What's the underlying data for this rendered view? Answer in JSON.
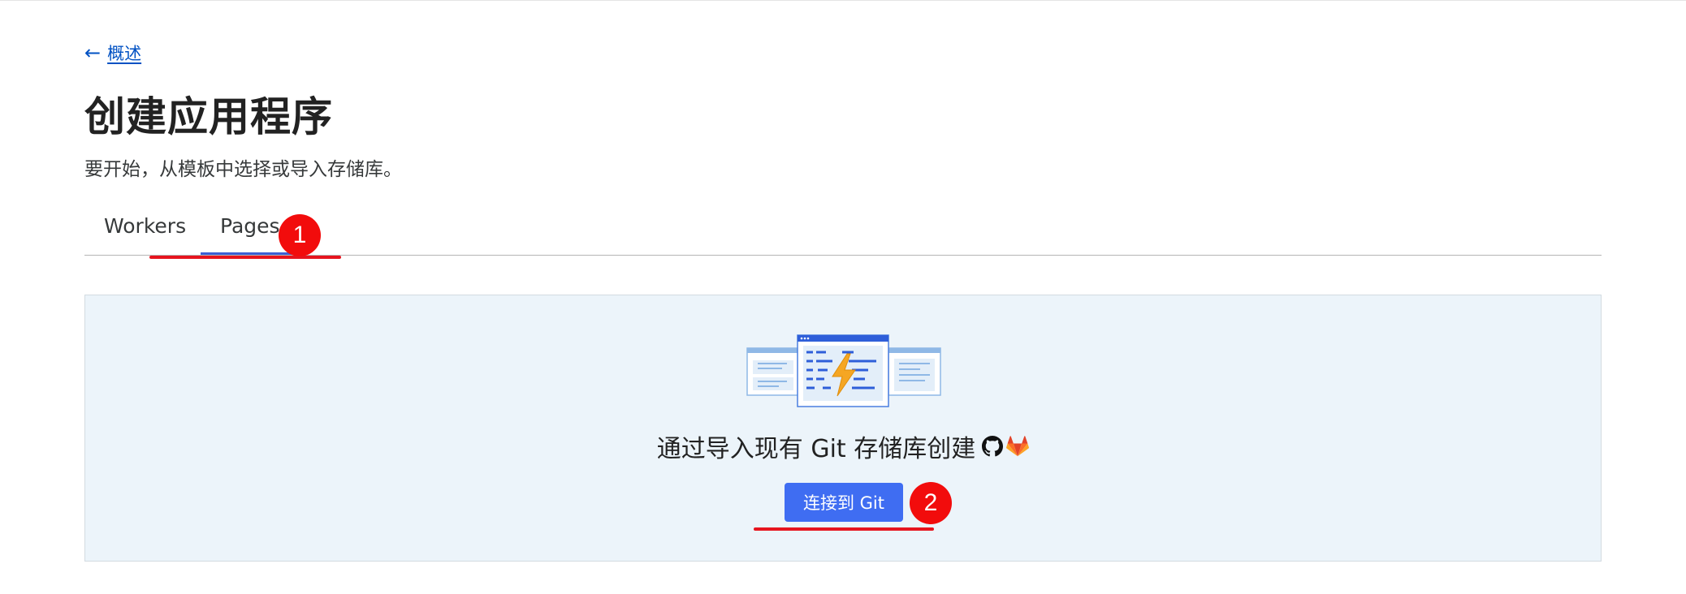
{
  "nav": {
    "back_label": "概述",
    "back_icon": "arrow-left-icon"
  },
  "header": {
    "title": "创建应用程序",
    "subtitle": "要开始，从模板中选择或导入存储库。"
  },
  "tabs": [
    {
      "label": "Workers",
      "active": false
    },
    {
      "label": "Pages",
      "active": true
    }
  ],
  "annotations": [
    {
      "number": "1",
      "color": "#f20c0c"
    },
    {
      "number": "2",
      "color": "#f20c0c"
    }
  ],
  "panel": {
    "title": "通过导入现有 Git 存储库创建",
    "icons": [
      "github-icon",
      "gitlab-icon"
    ],
    "connect_button": "连接到 Git"
  },
  "colors": {
    "link": "#0051c3",
    "primary_button": "#3f6df2",
    "panel_bg": "#ecf4fa",
    "annotation_red": "#e6141e"
  }
}
